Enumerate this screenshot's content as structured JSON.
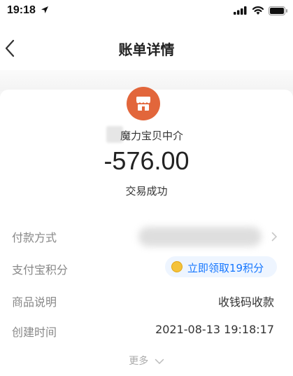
{
  "status_bar": {
    "time": "19:18"
  },
  "nav": {
    "title": "账单详情"
  },
  "bill": {
    "merchant_name": "魔力宝贝中介",
    "amount": "-576.00",
    "status": "交易成功"
  },
  "rows": {
    "payment_method": {
      "label": "付款方式",
      "value": ""
    },
    "alipay_points": {
      "label": "支付宝积分",
      "value": "立即领取19积分"
    },
    "product_desc": {
      "label": "商品说明",
      "value": "收钱码收款"
    },
    "create_time": {
      "label": "创建时间",
      "value": "2021-08-13 19:18:17"
    }
  },
  "more": {
    "label": "更多"
  },
  "colors": {
    "accent": "#1677ff",
    "shop_icon": "#e2663b",
    "coin": "#f4c23a"
  }
}
